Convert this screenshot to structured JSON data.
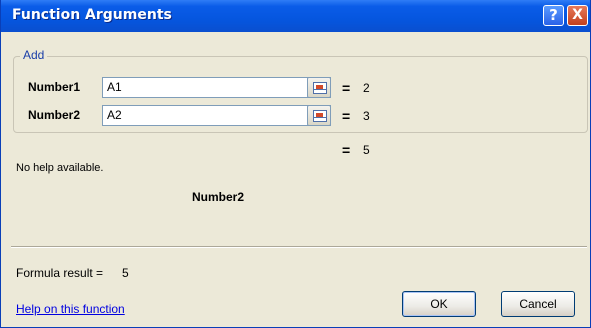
{
  "window": {
    "title": "Function Arguments",
    "help_button": "?",
    "close_button": "X"
  },
  "function": {
    "name": "Add",
    "arguments": [
      {
        "label": "Number1",
        "value": "A1",
        "equals": "=",
        "result": "2"
      },
      {
        "label": "Number2",
        "value": "A2",
        "equals": "=",
        "result": "3"
      }
    ],
    "function_equals": "=",
    "function_result": "5"
  },
  "help": {
    "text": "No help available.",
    "argument_description": "Number2"
  },
  "formula": {
    "label": "Formula result =",
    "value": "5"
  },
  "footer": {
    "help_link": "Help on this function",
    "ok_label": "OK",
    "cancel_label": "Cancel"
  },
  "colors": {
    "titlebar": "#0556df",
    "dialog_background": "#ece9d8",
    "group_label": "#1a3ea8",
    "link": "#0000e0",
    "close_button": "#c3401d"
  }
}
